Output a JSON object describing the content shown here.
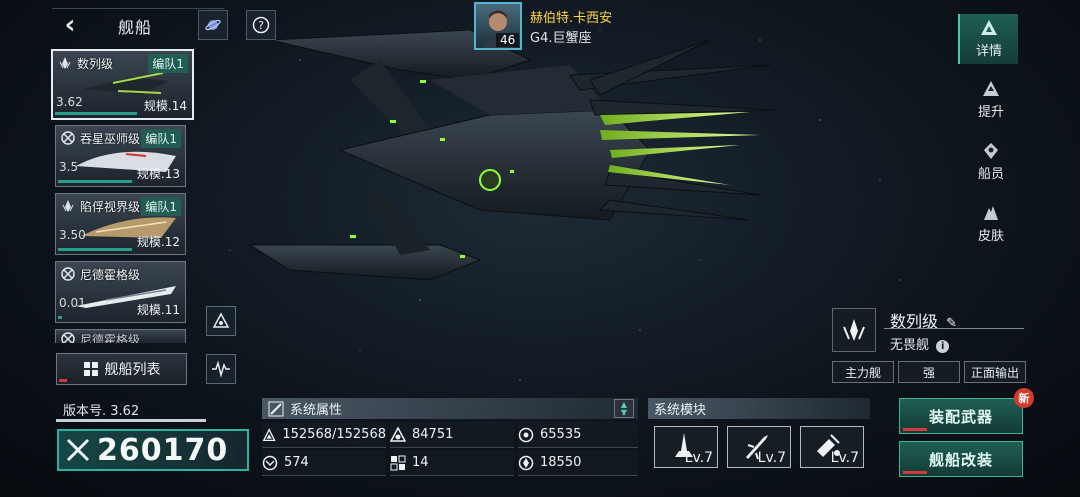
{
  "header": {
    "title": "舰船"
  },
  "commander": {
    "name": "赫伯特.卡西安",
    "level": "46",
    "class": "G4.巨蟹座"
  },
  "ship_list": [
    {
      "name": "数列级",
      "fleet": "编队1",
      "version": "3.62",
      "scale": "规模.14",
      "selected": true
    },
    {
      "name": "吞星巫师级",
      "fleet": "编队1",
      "version": "3.5",
      "scale": "规模.13",
      "selected": false
    },
    {
      "name": "陷俘视界级",
      "fleet": "编队1",
      "version": "3.50",
      "scale": "规模.12",
      "selected": false
    },
    {
      "name": "尼德霍格级",
      "fleet": "",
      "version": "0.01",
      "scale": "规模.11",
      "selected": false
    },
    {
      "name": "尼德霍格级",
      "fleet": "",
      "version": "",
      "scale": "",
      "selected": false
    }
  ],
  "ship_list_button": "舰船列表",
  "version_label": "版本号. 3.62",
  "combat_power": "260170",
  "attributes": {
    "title": "系统属性",
    "items": [
      {
        "icon": "armor-icon",
        "value": "152568/152568"
      },
      {
        "icon": "shield-icon",
        "value": "84751"
      },
      {
        "icon": "energy-icon",
        "value": "65535"
      },
      {
        "icon": "speed-icon",
        "value": "574"
      },
      {
        "icon": "grid-icon",
        "value": "14"
      },
      {
        "icon": "radar-icon",
        "value": "18550"
      }
    ]
  },
  "modules": {
    "title": "系统模块",
    "slots": [
      {
        "icon": "cannon-icon",
        "level": "Lv.7"
      },
      {
        "icon": "missile-icon",
        "level": "Lv.7"
      },
      {
        "icon": "drone-icon",
        "level": "Lv.7"
      }
    ]
  },
  "ship_info": {
    "name": "数列级",
    "type": "无畏舰",
    "tags": [
      "主力舰",
      "强",
      "正面输出"
    ]
  },
  "actions": {
    "equip": "装配武器",
    "modify": "舰船改装",
    "new_badge": "新"
  },
  "nav": [
    {
      "label": "详情",
      "icon": "details-icon",
      "active": true
    },
    {
      "label": "提升",
      "icon": "upgrade-icon",
      "active": false
    },
    {
      "label": "船员",
      "icon": "crew-icon",
      "active": false
    },
    {
      "label": "皮肤",
      "icon": "skin-icon",
      "active": false
    }
  ],
  "colors": {
    "accent": "#2cb3a2",
    "gold": "#ffd54a",
    "alert": "#d33a2a"
  }
}
